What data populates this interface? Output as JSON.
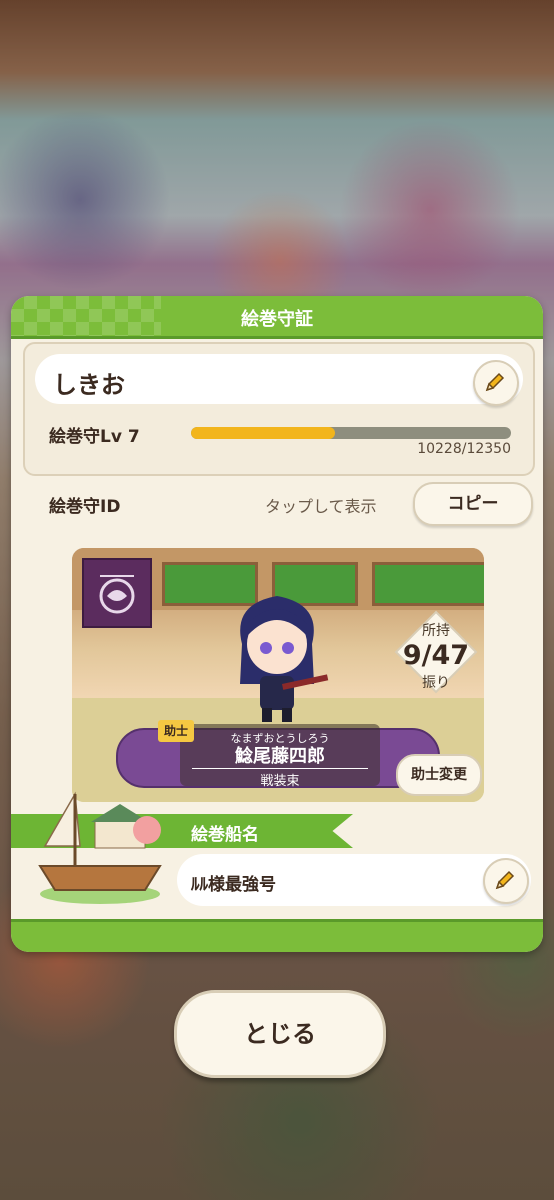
{
  "card": {
    "title": "絵巻守証",
    "player_name": "しきお",
    "level_label": "絵巻守Lv 7",
    "xp_text": "10228/12350",
    "xp_fraction": 0.45,
    "id_label": "絵巻守ID",
    "id_tap_text": "タップして表示",
    "copy_label": "コピー"
  },
  "assistant": {
    "owned_label": "所持",
    "owned_count": "9/47",
    "owned_unit": "振り",
    "tag": "助士",
    "furigana": "なまずおとうしろう",
    "name": "鯰尾藤四郎",
    "costume": "戦装束",
    "change_label": "助士変更"
  },
  "ship": {
    "title": "絵巻船名",
    "name": "ﾙﾙ様最強号"
  },
  "close_label": "とじる",
  "colors": {
    "accent_green": "#7cbd3a",
    "xp_fill": "#f2b51c",
    "panel_bg": "#f7f1e3"
  },
  "icons": [
    "pencil-icon",
    "crest-icon",
    "ship-icon"
  ]
}
